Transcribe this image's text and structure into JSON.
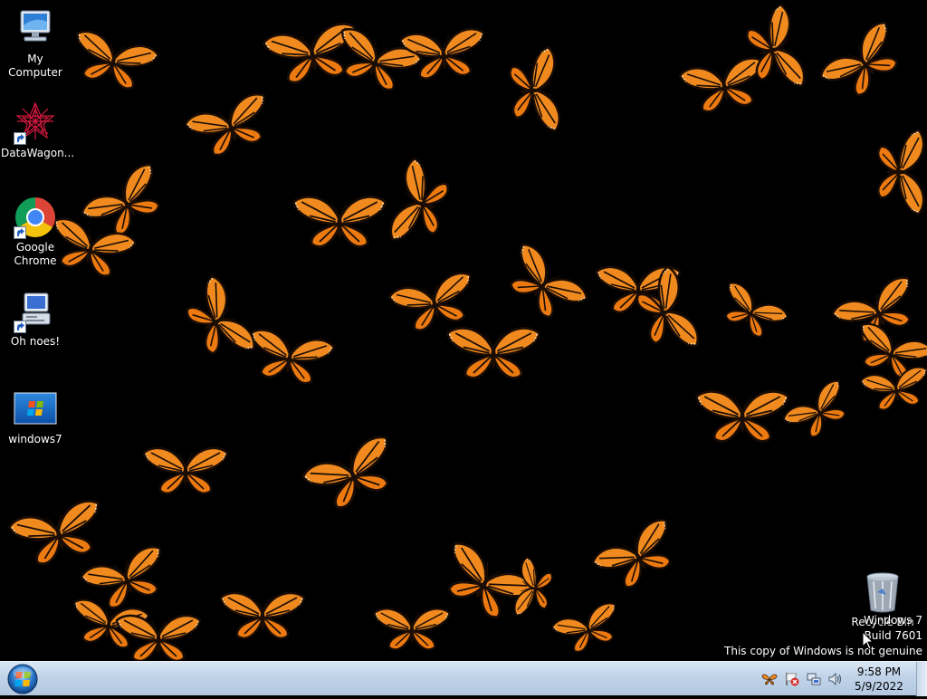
{
  "desktop": {
    "icons": [
      {
        "label": "My Computer",
        "icon": "computer-icon"
      },
      {
        "label": "DataWagon...",
        "icon": "datawagon-icon"
      },
      {
        "label": "Google Chrome",
        "icon": "chrome-icon"
      },
      {
        "label": "Oh noes!",
        "icon": "oh-noes-icon"
      },
      {
        "label": "windows7",
        "icon": "windows7-image-icon"
      },
      {
        "label": "Recycle Bin",
        "icon": "recycle-bin-icon"
      }
    ],
    "wallpaper": "monarch-butterflies",
    "watermark": {
      "line1": "Windows 7",
      "line2": "Build 7601",
      "line3": "This copy of Windows is not genuine"
    }
  },
  "taskbar": {
    "start_icon": "windows-orb-icon",
    "tray_icons": [
      "butterfly-app-icon",
      "action-center-flag-icon",
      "network-icon",
      "volume-icon"
    ],
    "clock": {
      "time": "9:58 PM",
      "date": "5/9/2022"
    }
  },
  "colors": {
    "desktop": "#000000",
    "butterfly": "#f08a1e",
    "vein": "#1a0d05",
    "taskbar": "#c0d3e8"
  }
}
